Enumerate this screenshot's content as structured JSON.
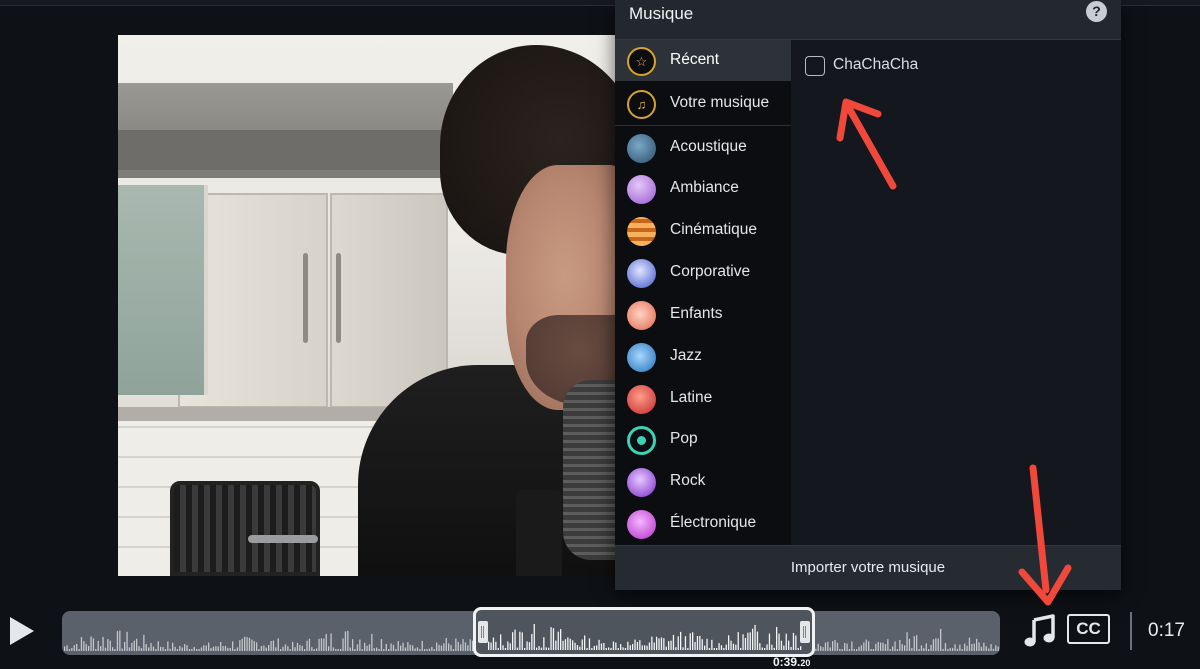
{
  "panel": {
    "title": "Musique",
    "help_glyph": "?",
    "categories": [
      {
        "label": "Récent",
        "icon": "star-icon",
        "active": true
      },
      {
        "label": "Votre musique",
        "icon": "music-note-icon"
      },
      {
        "label": "Acoustique",
        "icon": "acoustique-icon"
      },
      {
        "label": "Ambiance",
        "icon": "ambiance-icon"
      },
      {
        "label": "Cinématique",
        "icon": "cinematique-icon"
      },
      {
        "label": "Corporative",
        "icon": "corporative-icon"
      },
      {
        "label": "Enfants",
        "icon": "enfants-icon"
      },
      {
        "label": "Jazz",
        "icon": "jazz-icon"
      },
      {
        "label": "Latine",
        "icon": "latine-icon"
      },
      {
        "label": "Pop",
        "icon": "pop-icon"
      },
      {
        "label": "Rock",
        "icon": "rock-icon"
      },
      {
        "label": "Électronique",
        "icon": "electronique-icon"
      }
    ],
    "tracks": [
      {
        "label": "ChaChaCha",
        "checked": false
      }
    ],
    "import_label": "Importer votre musique"
  },
  "player": {
    "cc_label": "CC",
    "duration": "0:17",
    "time_marker_main": "0:39.",
    "time_marker_frac": "20"
  },
  "colors": {
    "accent_ring": "#d6a42c",
    "annotation_arrow": "#f0483a"
  }
}
